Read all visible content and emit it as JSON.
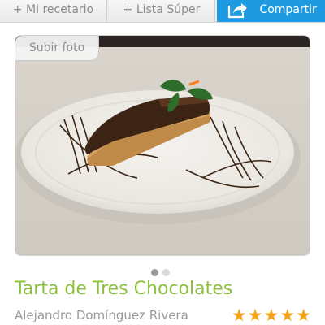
{
  "toolbar": {
    "recetario_label": "+ Mi recetario",
    "super_label": "+ Lista Súper",
    "share_label": "Compartir",
    "share_icon": "share-arrow-icon",
    "share_color": "#1e9be0"
  },
  "photo": {
    "upload_label": "Subir foto",
    "pager": {
      "current": 1,
      "total": 2
    }
  },
  "recipe": {
    "title": "Tarta de Tres Chocolates",
    "author": "Alejandro Domínguez Rivera",
    "rating_stars": "★★★★★",
    "rating": 5,
    "title_color": "#8cc03c",
    "star_color": "#f3a41c"
  }
}
